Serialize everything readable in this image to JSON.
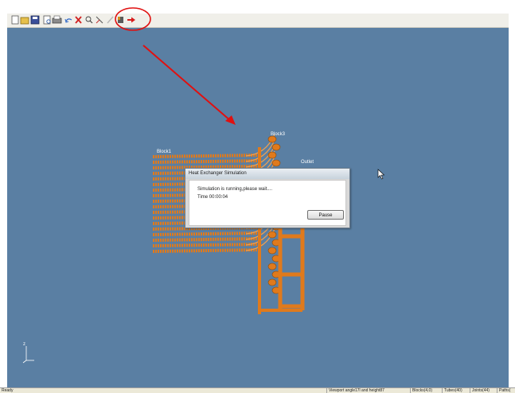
{
  "toolbar": {
    "buttons": [
      "new-icon",
      "open-icon",
      "save-icon",
      "preview-icon",
      "print-icon",
      "undo-icon",
      "delete-icon",
      "zoom-icon",
      "line-icon",
      "pencil-icon",
      "dot-icon",
      "run-arrow-icon"
    ]
  },
  "viewport": {
    "labels": {
      "block1": "Block1",
      "block3": "Block3",
      "outlet": "Outlet",
      "axis_z": "z"
    },
    "colors": {
      "background": "#5a7fa3",
      "model": "#e07a1c"
    }
  },
  "dialog": {
    "title": "Heat Exchanger Simulation",
    "message": "Simulation is running,please wait....",
    "time": "Time 00:00:04",
    "pause_label": "Pause"
  },
  "annotation": {
    "circle_color": "#e01010",
    "arrow_color": "#e01010"
  },
  "status": {
    "ready": "Ready",
    "viewport": "Viewport angle17l and height87",
    "blocks": "Blocks(4,0)",
    "tubes": "Tubes(40)",
    "joints": "Joints(44)",
    "paths": "Paths("
  }
}
